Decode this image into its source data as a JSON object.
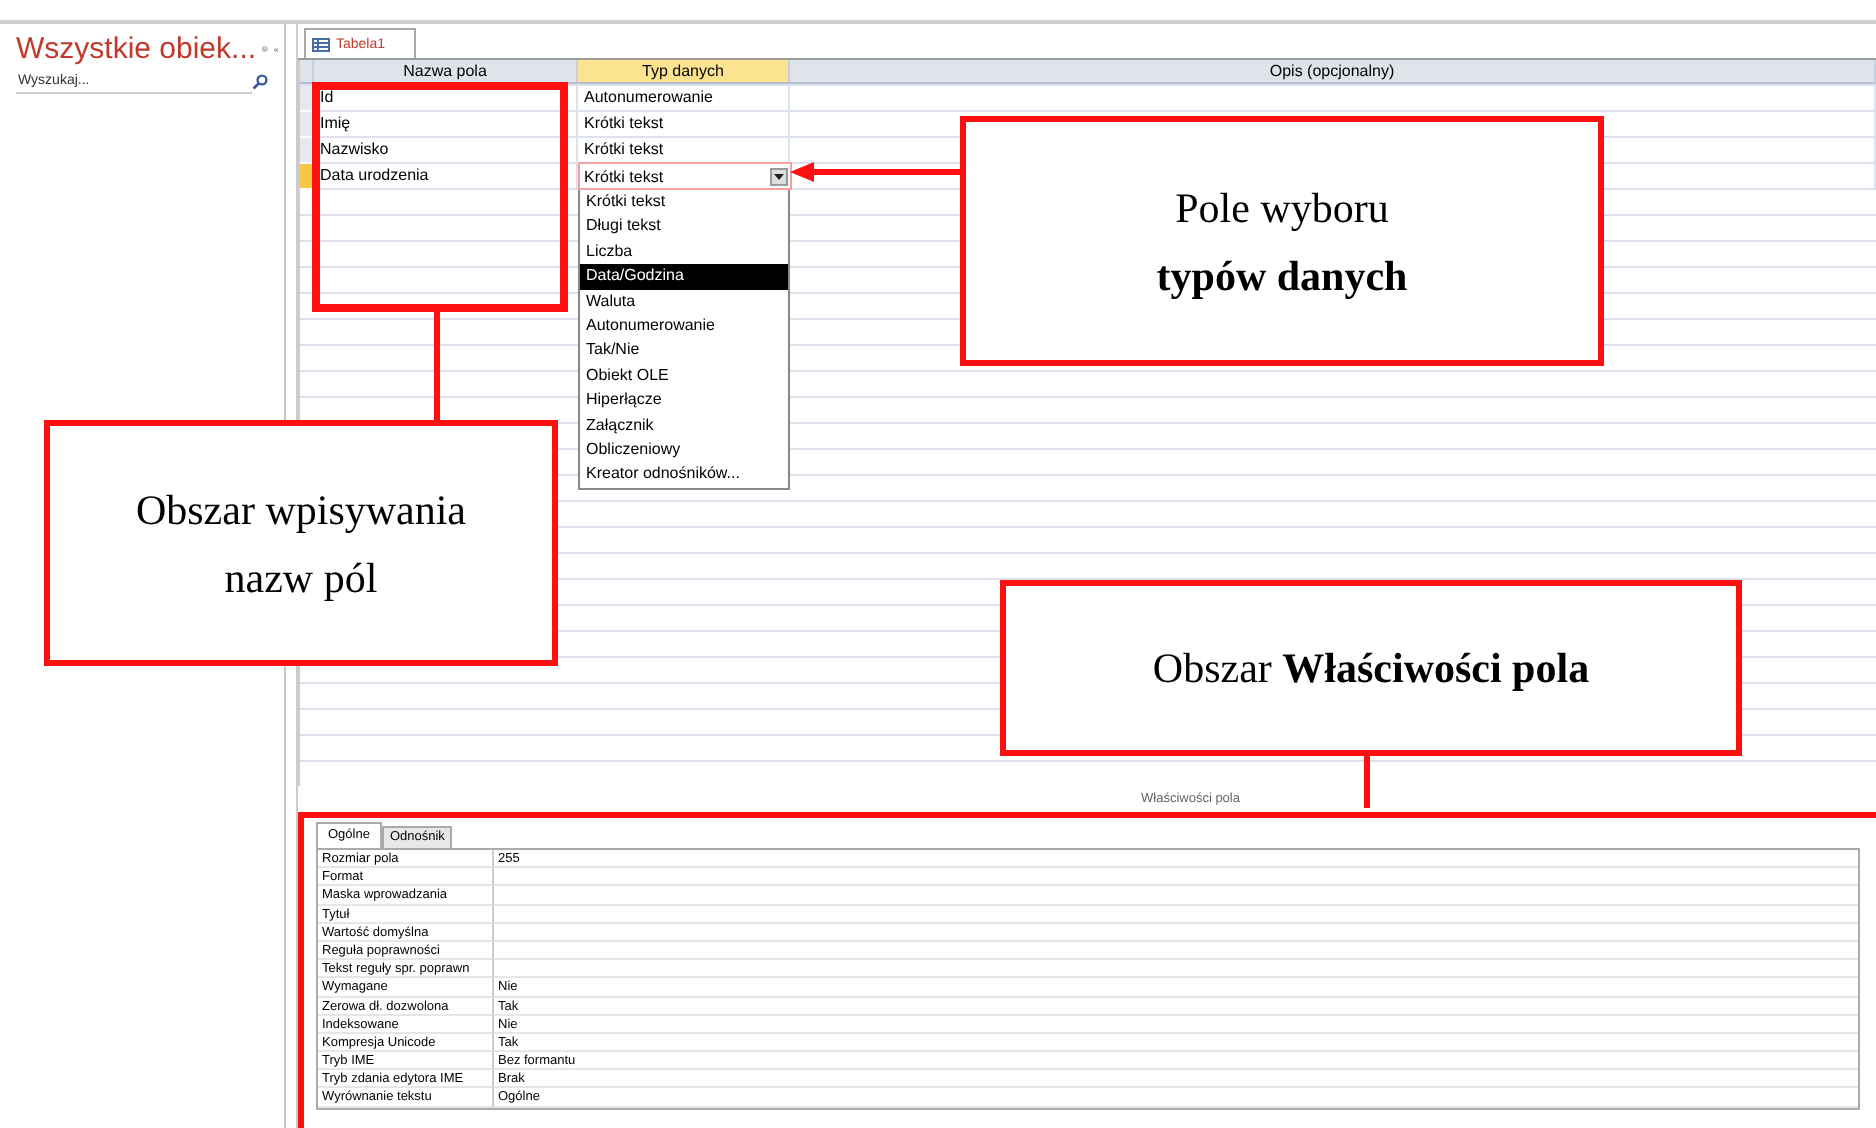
{
  "navigation_pane": {
    "title": "Wszystkie obiek...",
    "search": {
      "placeholder": "Wyszukaj..."
    }
  },
  "document_tab": {
    "label": "Tabela1",
    "selected": true
  },
  "design_grid": {
    "columns": [
      "Nazwa pola",
      "Typ danych",
      "Opis (opcjonalny)"
    ],
    "rows": [
      {
        "name": "Id",
        "type": "Autonumerowanie",
        "selected": false
      },
      {
        "name": "Imię",
        "type": "Krótki tekst",
        "selected": false
      },
      {
        "name": "Nazwisko",
        "type": "Krótki tekst",
        "selected": false
      },
      {
        "name": "Data urodzenia",
        "type": "Krótki tekst",
        "selected": true
      }
    ]
  },
  "type_dropdown": {
    "options": [
      {
        "label": "Krótki tekst",
        "selected": false
      },
      {
        "label": "Długi tekst",
        "selected": false
      },
      {
        "label": "Liczba",
        "selected": false
      },
      {
        "label": "Data/Godzina",
        "selected": true
      },
      {
        "label": "Waluta",
        "selected": false
      },
      {
        "label": "Autonumerowanie",
        "selected": false
      },
      {
        "label": "Tak/Nie",
        "selected": false
      },
      {
        "label": "Obiekt OLE",
        "selected": false
      },
      {
        "label": "Hiperłącze",
        "selected": false
      },
      {
        "label": "Załącznik",
        "selected": false
      },
      {
        "label": "Obliczeniowy",
        "selected": false
      },
      {
        "label": "Kreator odnośników...",
        "selected": false
      }
    ]
  },
  "field_properties": {
    "caption": "Właściwości pola",
    "tabs": [
      {
        "label": "Ogólne",
        "selected": true
      },
      {
        "label": "Odnośnik",
        "selected": false
      }
    ],
    "rows": [
      {
        "name": "Rozmiar pola",
        "value": "255"
      },
      {
        "name": "Format"
      },
      {
        "name": "Maska wprowadzania"
      },
      {
        "name": "Tytuł"
      },
      {
        "name": "Wartość domyślna"
      },
      {
        "name": "Reguła poprawności"
      },
      {
        "name": "Tekst reguły spr. poprawn"
      },
      {
        "name": "Wymagane",
        "value": "Nie"
      },
      {
        "name": "Zerowa dł. dozwolona",
        "value": "Tak"
      },
      {
        "name": "Indeksowane",
        "value": "Nie"
      },
      {
        "name": "Kompresja Unicode",
        "value": "Tak"
      },
      {
        "name": "Tryb IME",
        "value": "Bez formantu"
      },
      {
        "name": "Tryb zdania edytora IME",
        "value": "Brak"
      },
      {
        "name": "Wyrównanie tekstu",
        "value": "Ogólne"
      }
    ]
  },
  "callouts": [
    {
      "kind": "types",
      "lines": [
        "Pole wyboru",
        "**typów danych**"
      ]
    },
    {
      "kind": "names",
      "lines": [
        "Obszar wpisywania",
        "nazw pól"
      ]
    },
    {
      "kind": "properties",
      "lines": [
        "Obszar **Właściwości pola**"
      ]
    }
  ]
}
